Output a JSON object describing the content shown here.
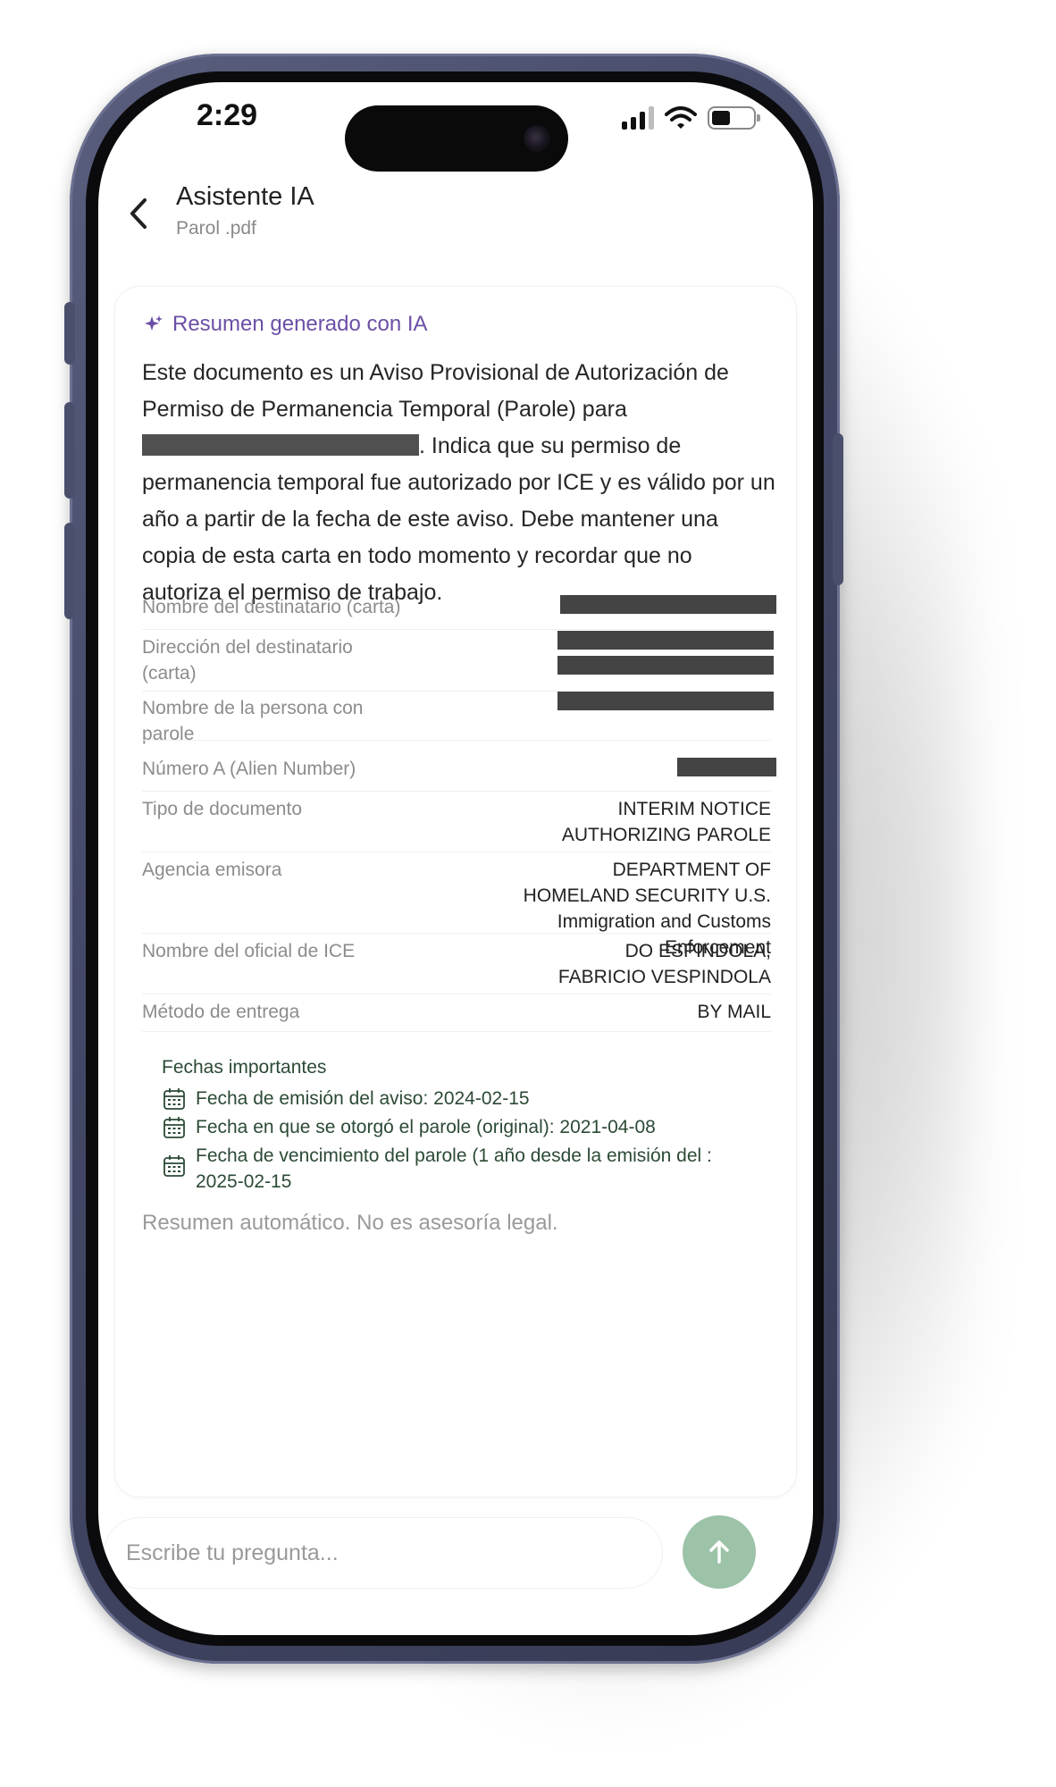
{
  "status_bar": {
    "time": "2:29"
  },
  "header": {
    "title": "Asistente IA",
    "subtitle": "Parol .pdf"
  },
  "summary_card": {
    "ai_label": "Resumen generado con IA",
    "paragraph_start": "Este documento es un Aviso Provisional de Autorización de Permiso de Permanencia Temporal (Parole) para ",
    "paragraph_end": ". Indica que su permiso de permanencia temporal fue autorizado por ICE y es válido por un año a partir de la fecha de este aviso. Debe mantener una copia de esta carta en todo momento y recordar que no autoriza el permiso de trabajo.",
    "fields": {
      "recipient_name_label": "Nombre del destinatario (carta)",
      "recipient_address_label": "Dirección del destinatario (carta)",
      "parolee_name_label": "Nombre de la persona con parole",
      "alien_number_label": "Número A (Alien Number)",
      "doc_type_label": "Tipo de documento",
      "doc_type_value": "INTERIM NOTICE AUTHORIZING PAROLE",
      "agency_label": "Agencia emisora",
      "agency_value": "DEPARTMENT OF HOMELAND SECURITY U.S. Immigration and Customs Enforcement",
      "officer_label": "Nombre del oficial de ICE",
      "officer_value": "DO ESPINDOLA, FABRICIO VESPINDOLA",
      "delivery_label": "Método de entrega",
      "delivery_value": "BY MAIL"
    },
    "dates": {
      "title": "Fechas importantes",
      "items": [
        "Fecha de emisión del aviso: 2024-02-15",
        "Fecha en que se otorgó el parole (original): 2021-04-08",
        "Fecha de vencimiento del parole (1 año desde la emisión del : 2025-02-15"
      ]
    },
    "disclaimer": "Resumen automático. No es asesoría legal."
  },
  "composer": {
    "placeholder": "Escribe tu pregunta..."
  },
  "colors": {
    "accent_purple": "#6b4fa6",
    "send_green": "#9cc2a7",
    "date_text": "#2c4a35",
    "frame": "#434866"
  }
}
